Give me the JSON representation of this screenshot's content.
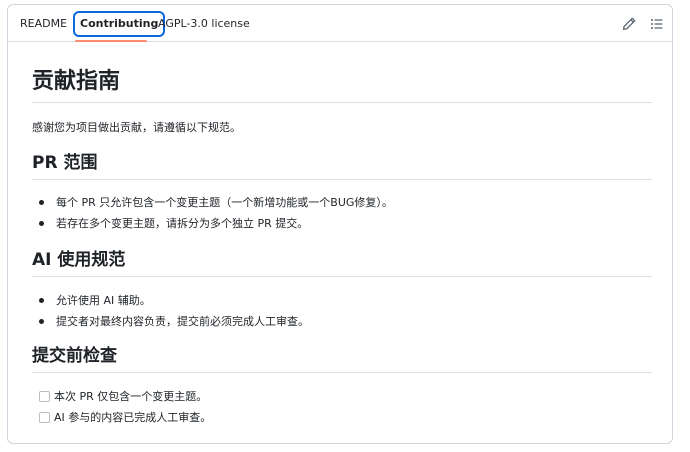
{
  "tabs": {
    "readme": "README",
    "contributing": "Contributing",
    "license": "AGPL-3.0 license"
  },
  "toolbar": {
    "edit_icon": "pencil-icon",
    "toc_icon": "list-icon"
  },
  "doc": {
    "title": "贡献指南",
    "intro": "感谢您为项目做出贡献，请遵循以下规范。",
    "sections": [
      {
        "heading": "PR 范围",
        "items": [
          "每个 PR 只允许包含一个变更主题（一个新增功能或一个BUG修复）。",
          "若存在多个变更主题，请拆分为多个独立 PR 提交。"
        ]
      },
      {
        "heading": "AI 使用规范",
        "items": [
          "允许使用 AI 辅助。",
          "提交者对最终内容负责，提交前必须完成人工审查。"
        ]
      },
      {
        "heading": "提交前检查",
        "tasks": [
          {
            "label": "本次 PR 仅包含一个变更主题。",
            "checked": false
          },
          {
            "label": "AI 参与的内容已完成人工审查。",
            "checked": false
          }
        ]
      }
    ]
  },
  "colors": {
    "accent": "#0969da",
    "tab_underline": "#fd8c73",
    "border": "#d0d7de",
    "text": "#1f2328"
  }
}
